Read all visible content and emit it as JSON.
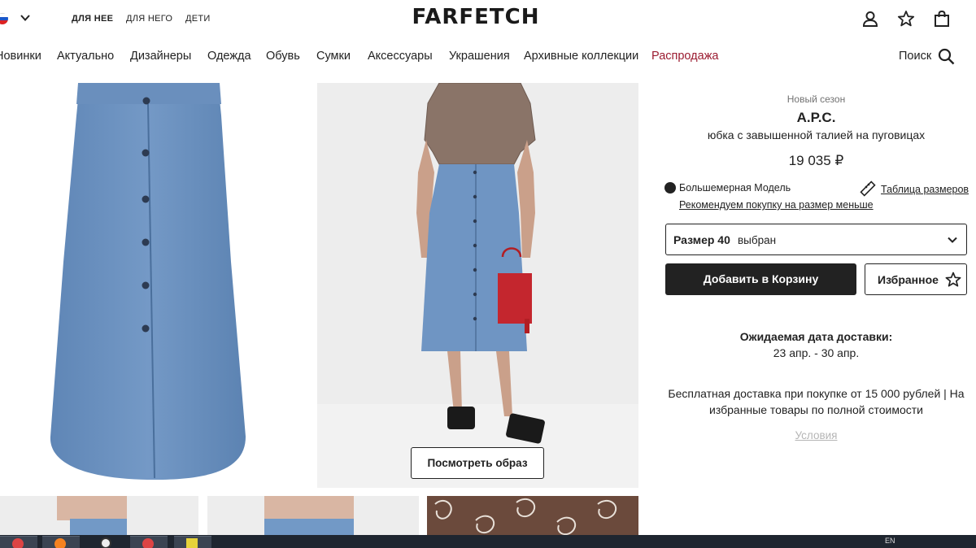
{
  "header": {
    "logo": "FARFETCH",
    "gender_tabs": [
      {
        "label": "ДЛЯ НЕЕ",
        "active": true
      },
      {
        "label": "ДЛЯ НЕГО",
        "active": false
      },
      {
        "label": "ДЕТИ",
        "active": false
      }
    ],
    "icons": [
      "flag-icon",
      "chevron-down-icon",
      "account-icon",
      "star-icon",
      "bag-icon"
    ]
  },
  "nav": {
    "items": [
      "Новинки",
      "Актуально",
      "Дизайнеры",
      "Одежда",
      "Обувь",
      "Сумки",
      "Аксессуары",
      "Украшения",
      "Архивные коллекции",
      "Распродажа"
    ],
    "sale_color": "#9b1b30",
    "search_label": "Поиск"
  },
  "gallery": {
    "look_button": "Посмотреть образ"
  },
  "product": {
    "season": "Новый сезон",
    "brand": "A.P.C.",
    "name": "юбка с завышенной талией на пуговицах",
    "price": "19 035 ₽",
    "fit_label": "Большемерная Модель",
    "fit_recommendation": "Рекомендуем покупку на размер меньше",
    "size_guide": "Таблица размеров",
    "size_label": "Размер 40",
    "size_state": "выбран",
    "add_to_cart": "Добавить в Корзину",
    "wishlist": "Избранное"
  },
  "delivery": {
    "title": "Ожидаемая дата доставки:",
    "dates": "23 апр. - 30 апр.",
    "free_shipping": "Бесплатная доставка при покупке от 15 000 рублей | На избранные товары по полной стоимости",
    "terms": "Условия"
  },
  "taskbar": {
    "lang": "EN"
  }
}
